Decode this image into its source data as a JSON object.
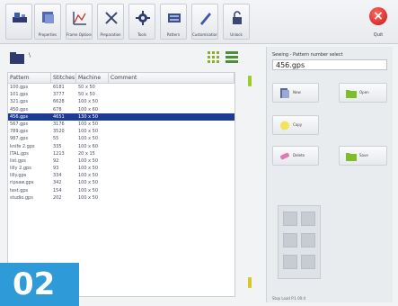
{
  "toolbar": {
    "buttons": [
      {
        "label": "",
        "icon": "machine-icon"
      },
      {
        "label": "Properties",
        "icon": "properties-icon"
      },
      {
        "label": "Frame Options",
        "icon": "frame-options-icon"
      },
      {
        "label": "Preparation",
        "icon": "preparation-icon"
      },
      {
        "label": "Tools",
        "icon": "tools-icon"
      },
      {
        "label": "Pattern",
        "icon": "pattern-icon"
      },
      {
        "label": "Customisation",
        "icon": "customisation-icon"
      },
      {
        "label": "Unlock",
        "icon": "unlock-icon"
      }
    ],
    "close_label": "Quit"
  },
  "left_panel": {
    "path": "\\",
    "columns": [
      "Pattern",
      "Stitches",
      "Machine",
      "Comment"
    ],
    "rows": [
      {
        "pattern": "100.gps",
        "stitches": "6181",
        "machine": "50 x 50",
        "comment": ""
      },
      {
        "pattern": "101.gps",
        "stitches": "3777",
        "machine": "50 x 50",
        "comment": ""
      },
      {
        "pattern": "321.gps",
        "stitches": "6628",
        "machine": "100 x 50",
        "comment": ""
      },
      {
        "pattern": "450.gps",
        "stitches": "678",
        "machine": "100 x 60",
        "comment": ""
      },
      {
        "pattern": "456.gps",
        "stitches": "4651",
        "machine": "130 x 50",
        "comment": "",
        "selected": true
      },
      {
        "pattern": "567.gps",
        "stitches": "3176",
        "machine": "100 x 50",
        "comment": ""
      },
      {
        "pattern": "789.gps",
        "stitches": "3520",
        "machine": "100 x 50",
        "comment": ""
      },
      {
        "pattern": "987.gps",
        "stitches": "55",
        "machine": "100 x 50",
        "comment": ""
      },
      {
        "pattern": "knife 2.gps",
        "stitches": "335",
        "machine": "100 x 60",
        "comment": ""
      },
      {
        "pattern": "ITAL.gps",
        "stitches": "1213",
        "machine": "20 x 15",
        "comment": ""
      },
      {
        "pattern": "list.gps",
        "stitches": "92",
        "machine": "100 x 50",
        "comment": ""
      },
      {
        "pattern": "lilly 2.gps",
        "stitches": "93",
        "machine": "100 x 50",
        "comment": ""
      },
      {
        "pattern": "lilly.gps",
        "stitches": "334",
        "machine": "100 x 50",
        "comment": ""
      },
      {
        "pattern": "ripsaw.gps",
        "stitches": "342",
        "machine": "100 x 50",
        "comment": ""
      },
      {
        "pattern": "test.gps",
        "stitches": "154",
        "machine": "100 x 50",
        "comment": ""
      },
      {
        "pattern": "studio.gps",
        "stitches": "202",
        "machine": "100 x 50",
        "comment": ""
      }
    ]
  },
  "right_panel": {
    "label": "Sewing - Pattern number select",
    "value": "456.gps",
    "actions": [
      {
        "label": "New",
        "icon": "new-pattern-icon"
      },
      {
        "label": "Open",
        "icon": "open-folder-icon"
      },
      {
        "label": "Copy",
        "icon": "copy-icon"
      },
      {
        "label": "Delete",
        "icon": "delete-icon"
      },
      {
        "label": "Save",
        "icon": "save-folder-icon"
      }
    ],
    "status": "Stop Load P.1   00:4"
  },
  "badge": "02"
}
